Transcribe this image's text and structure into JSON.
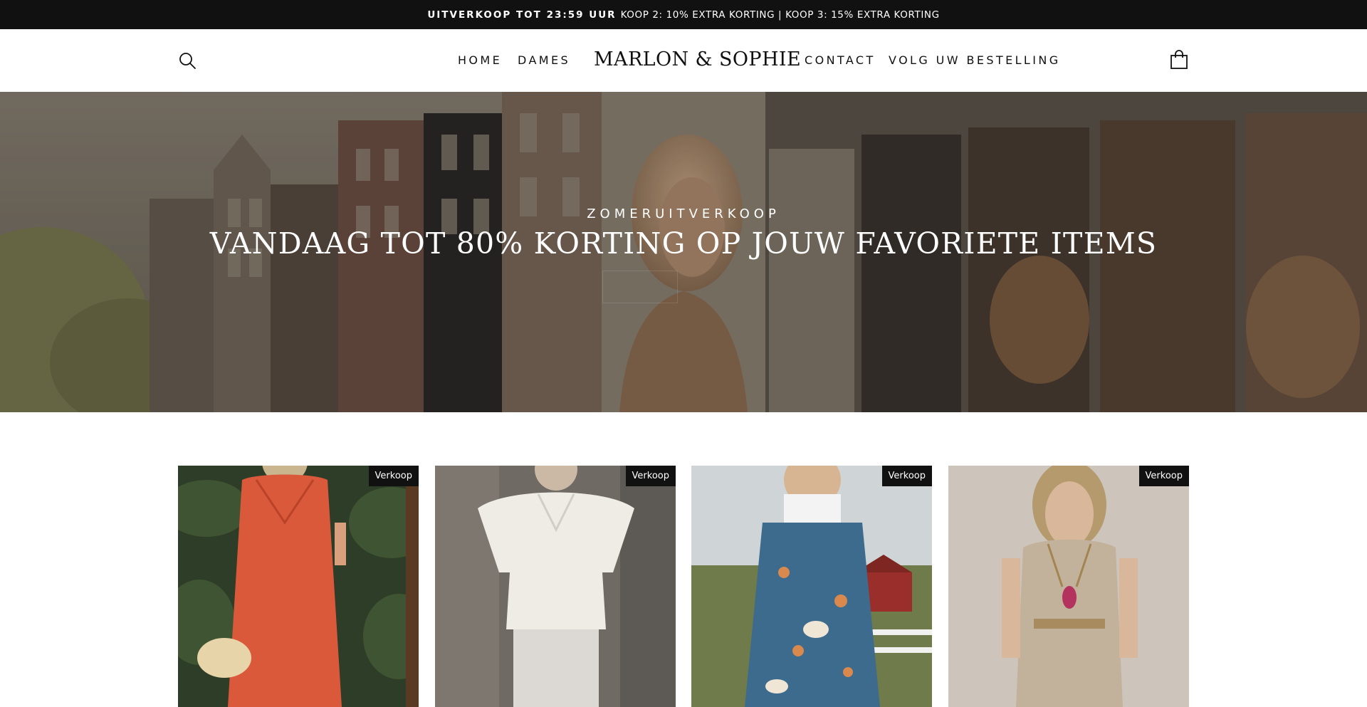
{
  "announcement": {
    "highlight": "UITVERKOOP TOT 23:59 UUR",
    "text": "KOOP 2: 10% EXTRA KORTING | KOOP 3: 15% EXTRA KORTING"
  },
  "header": {
    "nav_left": [
      "HOME",
      "DAMES"
    ],
    "logo": "MARLON & SOPHIE",
    "nav_right": [
      "CONTACT",
      "VOLG UW BESTELLING"
    ],
    "search_icon": "search-icon",
    "cart_icon": "shopping-bag-icon"
  },
  "hero": {
    "kicker": "ZOMERUITVERKOOP",
    "title": "VANDAAG TOT 80% KORTING OP JOUW FAVORIETE ITEMS"
  },
  "products": [
    {
      "badge": "Verkoop"
    },
    {
      "badge": "Verkoop"
    },
    {
      "badge": "Verkoop"
    },
    {
      "badge": "Verkoop"
    }
  ],
  "colors": {
    "announcement_bg": "#111111",
    "badge_bg": "#111111",
    "text": "#111111"
  }
}
